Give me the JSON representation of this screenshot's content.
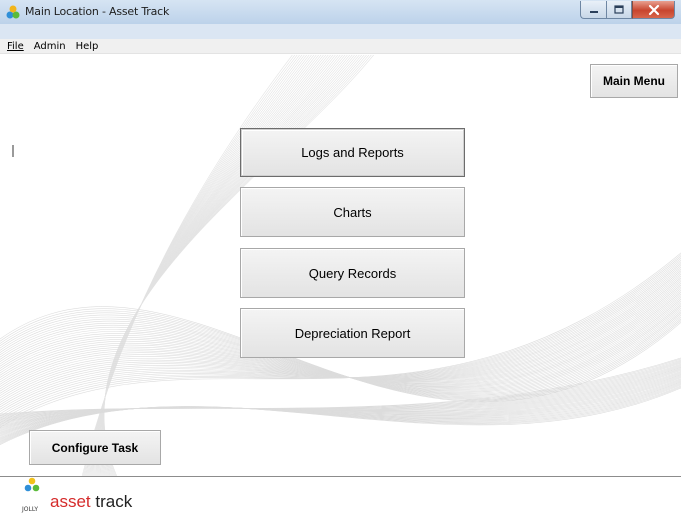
{
  "window": {
    "title": "Main Location - Asset Track"
  },
  "menubar": {
    "items": [
      "File",
      "Admin",
      "Help"
    ]
  },
  "main": {
    "main_menu_label": "Main Menu",
    "buttons": [
      "Logs and Reports",
      "Charts",
      "Query Records",
      "Depreciation Report"
    ],
    "configure_task_label": "Configure Task"
  },
  "footer": {
    "brand_word1": "asset",
    "brand_word2": "track",
    "brand_sub": "JOLLY"
  },
  "colors": {
    "brand_red": "#d52b2b",
    "title_bar": "#c9dbef",
    "close_button": "#c8452e"
  }
}
